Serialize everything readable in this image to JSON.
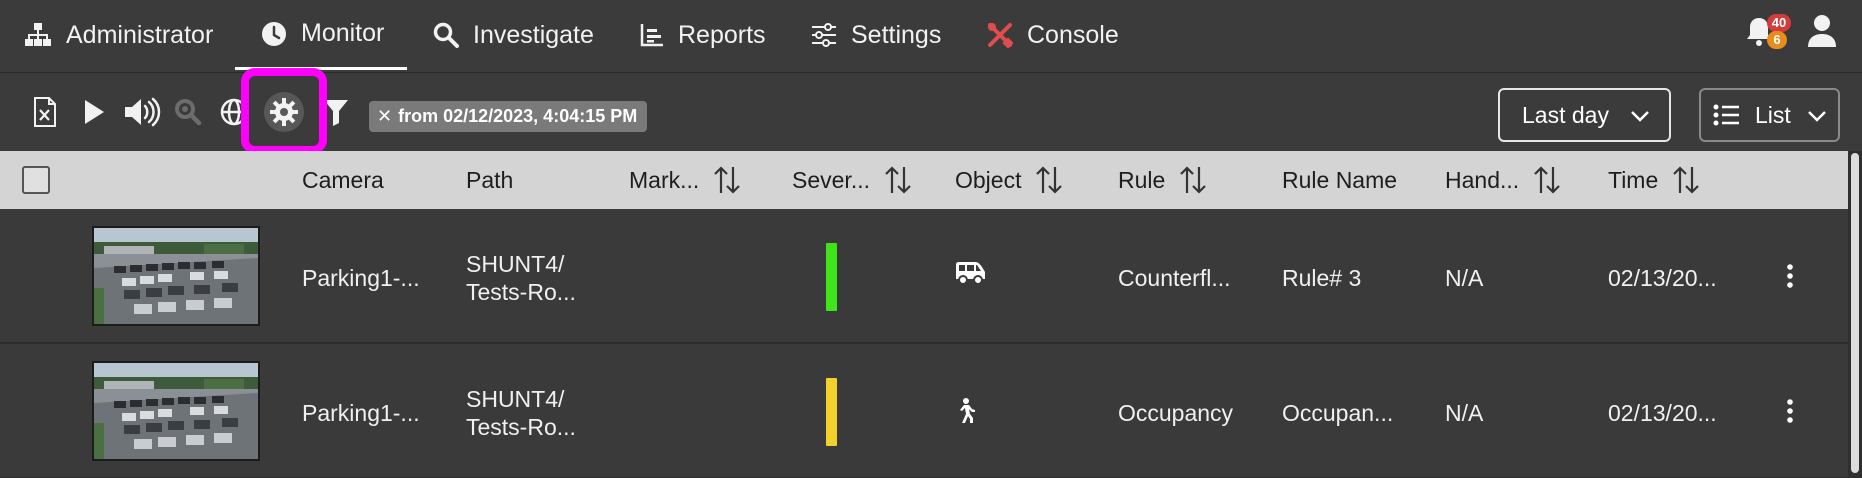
{
  "nav": {
    "tabs": [
      {
        "label": "Administrator",
        "icon": "sitemap-icon"
      },
      {
        "label": "Monitor",
        "icon": "clock-icon",
        "active": true
      },
      {
        "label": "Investigate",
        "icon": "search-icon"
      },
      {
        "label": "Reports",
        "icon": "bar-chart-icon"
      },
      {
        "label": "Settings",
        "icon": "sliders-icon"
      },
      {
        "label": "Console",
        "icon": "tools-icon"
      }
    ],
    "notifications": {
      "count_red": "40",
      "count_orange": "6"
    }
  },
  "toolbar": {
    "icons": [
      "excel-export-icon",
      "play-icon",
      "volume-icon",
      "zoom-search-icon",
      "globe-icon",
      "settings-gear-icon",
      "filter-icon"
    ],
    "filter_chip": "from 02/12/2023, 4:04:15 PM",
    "filter_chip_close": "✕",
    "range_select": "Last day",
    "view_select": "List"
  },
  "table": {
    "columns": [
      "Camera",
      "Path",
      "Mark...",
      "Sever...",
      "Object",
      "Rule",
      "Rule Name",
      "Hand...",
      "Time"
    ],
    "rows": [
      {
        "camera": "Parking1-...",
        "path_line1": "SHUNT4/",
        "path_line2": "Tests-Ro...",
        "severity_color": "#3fe51a",
        "object_icon": "van-icon",
        "rule": "Counterfl...",
        "rule_name": "Rule# 3",
        "handled": "N/A",
        "time": "02/13/20..."
      },
      {
        "camera": "Parking1-...",
        "path_line1": "SHUNT4/",
        "path_line2": "Tests-Ro...",
        "severity_color": "#f2d22a",
        "object_icon": "person-walking-icon",
        "rule": "Occupancy",
        "rule_name": "Occupan...",
        "handled": "N/A",
        "time": "02/13/20..."
      }
    ]
  },
  "colors": {
    "highlight": "#ff00ff",
    "console_icon": "#e24c4c",
    "header_bg": "#d4d4d4"
  }
}
